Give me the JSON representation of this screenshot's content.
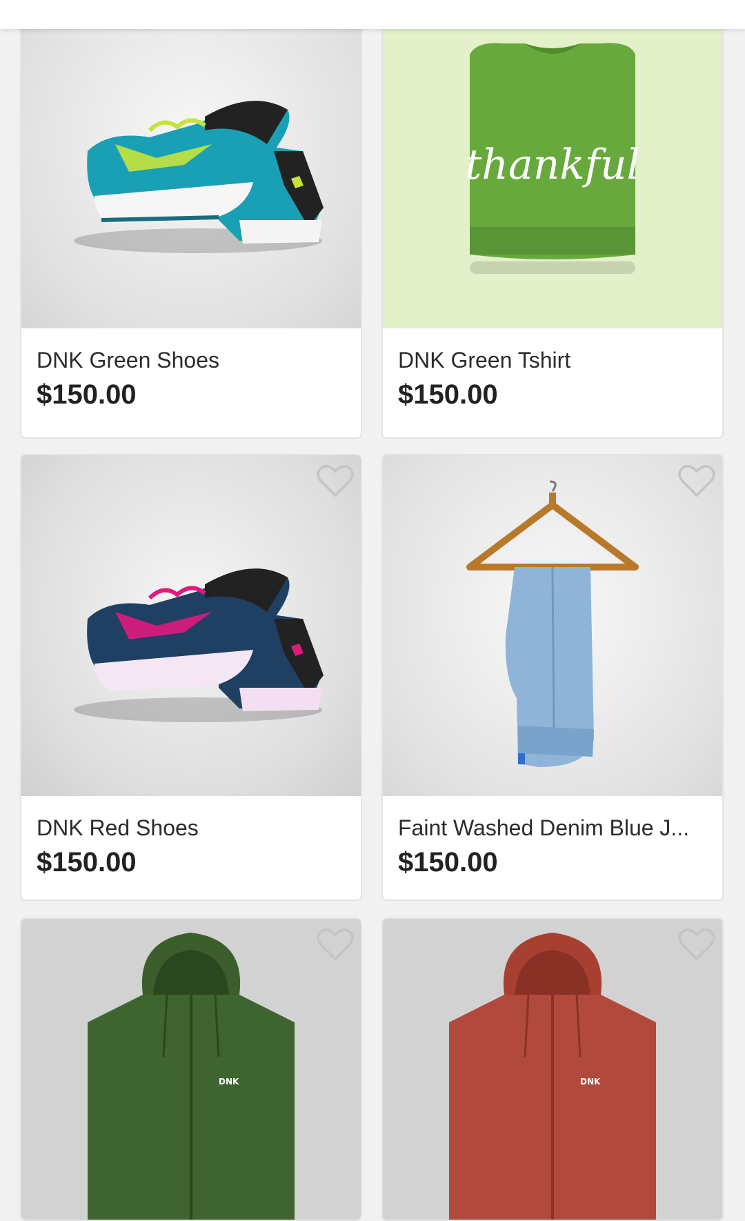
{
  "products": [
    {
      "name": "DNK Green Shoes",
      "price": "$150.00",
      "image": "green-sneakers",
      "bg": "#ececec"
    },
    {
      "name": "DNK Green Tshirt",
      "price": "$150.00",
      "image": "thankful-green-tshirt",
      "bg": "#e3f0c9",
      "print": "thankful"
    },
    {
      "name": "DNK Red Shoes",
      "price": "$150.00",
      "image": "red-sneakers",
      "bg": "#e4e4e4"
    },
    {
      "name": "Faint Washed Denim Blue J...",
      "price": "$150.00",
      "image": "jeans-on-hanger",
      "bg": "#ececec"
    },
    {
      "name": "",
      "price": "",
      "image": "green-hoodie",
      "bg": "#d2d2d2",
      "logo": "DNK"
    },
    {
      "name": "",
      "price": "",
      "image": "red-hoodie",
      "bg": "#d2d2d2",
      "logo": "DNK"
    }
  ],
  "icons": {
    "favorite": "heart-outline-icon"
  },
  "colors": {
    "heart_stroke": "#c4c4c4",
    "card_border": "#e3e3e3",
    "price_text": "#222222"
  }
}
